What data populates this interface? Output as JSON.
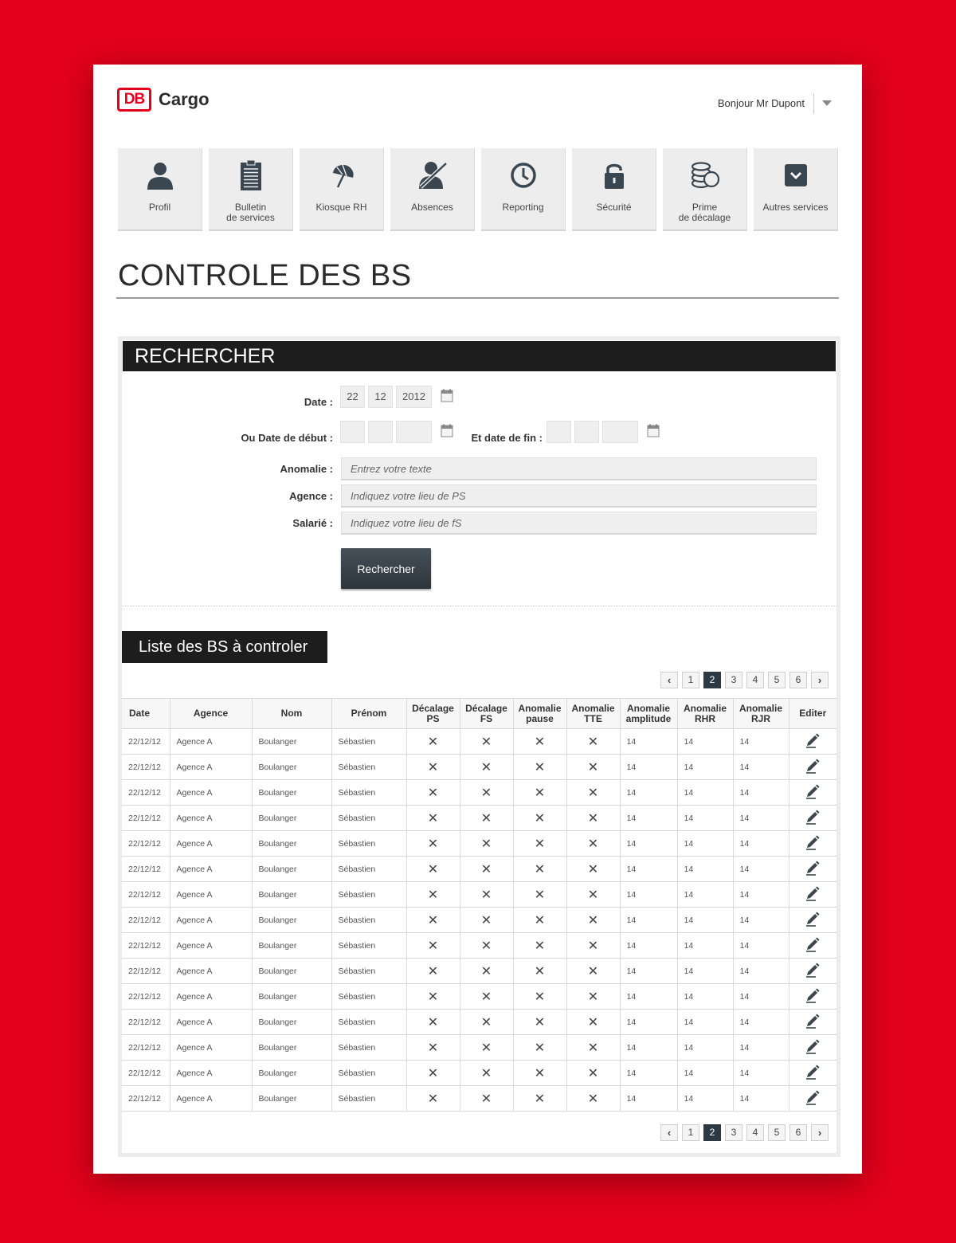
{
  "brand": {
    "logo_mark": "DB",
    "logo_text": "Cargo"
  },
  "header": {
    "greeting": "Bonjour Mr Dupont"
  },
  "nav": [
    {
      "label": "Profil",
      "icon": "user-icon"
    },
    {
      "label": "Bulletin\nde services",
      "icon": "clipboard-icon"
    },
    {
      "label": "Kiosque RH",
      "icon": "umbrella-icon"
    },
    {
      "label": "Absences",
      "icon": "user-crossed-icon"
    },
    {
      "label": "Reporting",
      "icon": "clock-icon"
    },
    {
      "label": "Sécurité",
      "icon": "lock-icon"
    },
    {
      "label": "Prime\nde décalage",
      "icon": "coins-icon"
    },
    {
      "label": "Autres services",
      "icon": "chevron-box-icon"
    }
  ],
  "page_title": "CONTROLE DES BS",
  "search": {
    "heading": "RECHERCHER",
    "date_label": "Date :",
    "date_day": "22",
    "date_month": "12",
    "date_year": "2012",
    "start_label": "Ou Date de début :",
    "end_label": "Et date de fin :",
    "anomalie_label": "Anomalie :",
    "anomalie_placeholder": "Entrez votre texte",
    "agence_label": "Agence :",
    "agence_placeholder": "Indiquez votre lieu de PS",
    "salarie_label": "Salarié :",
    "salarie_placeholder": "Indiquez votre lieu de fS",
    "button": "Rechercher"
  },
  "list": {
    "heading": "Liste des BS à controler",
    "pages": [
      "1",
      "2",
      "3",
      "4",
      "5",
      "6"
    ],
    "active_page": "2",
    "columns": [
      "Date",
      "Agence",
      "Nom",
      "Prénom",
      "Décalage\nPS",
      "Décalage\nFS",
      "Anomalie\npause",
      "Anomalie\nTTE",
      "Anomalie\namplitude",
      "Anomalie\nRHR",
      "Anomalie\nRJR",
      "Editer"
    ],
    "rows": [
      [
        "22/12/12",
        "Agence A",
        "Boulanger",
        "Sébastien",
        "✕",
        "✕",
        "✕",
        "✕",
        "14",
        "14",
        "14"
      ],
      [
        "22/12/12",
        "Agence A",
        "Boulanger",
        "Sébastien",
        "✕",
        "✕",
        "✕",
        "✕",
        "14",
        "14",
        "14"
      ],
      [
        "22/12/12",
        "Agence A",
        "Boulanger",
        "Sébastien",
        "✕",
        "✕",
        "✕",
        "✕",
        "14",
        "14",
        "14"
      ],
      [
        "22/12/12",
        "Agence A",
        "Boulanger",
        "Sébastien",
        "✕",
        "✕",
        "✕",
        "✕",
        "14",
        "14",
        "14"
      ],
      [
        "22/12/12",
        "Agence A",
        "Boulanger",
        "Sébastien",
        "✕",
        "✕",
        "✕",
        "✕",
        "14",
        "14",
        "14"
      ],
      [
        "22/12/12",
        "Agence A",
        "Boulanger",
        "Sébastien",
        "✕",
        "✕",
        "✕",
        "✕",
        "14",
        "14",
        "14"
      ],
      [
        "22/12/12",
        "Agence A",
        "Boulanger",
        "Sébastien",
        "✕",
        "✕",
        "✕",
        "✕",
        "14",
        "14",
        "14"
      ],
      [
        "22/12/12",
        "Agence A",
        "Boulanger",
        "Sébastien",
        "✕",
        "✕",
        "✕",
        "✕",
        "14",
        "14",
        "14"
      ],
      [
        "22/12/12",
        "Agence A",
        "Boulanger",
        "Sébastien",
        "✕",
        "✕",
        "✕",
        "✕",
        "14",
        "14",
        "14"
      ],
      [
        "22/12/12",
        "Agence A",
        "Boulanger",
        "Sébastien",
        "✕",
        "✕",
        "✕",
        "✕",
        "14",
        "14",
        "14"
      ],
      [
        "22/12/12",
        "Agence A",
        "Boulanger",
        "Sébastien",
        "✕",
        "✕",
        "✕",
        "✕",
        "14",
        "14",
        "14"
      ],
      [
        "22/12/12",
        "Agence A",
        "Boulanger",
        "Sébastien",
        "✕",
        "✕",
        "✕",
        "✕",
        "14",
        "14",
        "14"
      ],
      [
        "22/12/12",
        "Agence A",
        "Boulanger",
        "Sébastien",
        "✕",
        "✕",
        "✕",
        "✕",
        "14",
        "14",
        "14"
      ],
      [
        "22/12/12",
        "Agence A",
        "Boulanger",
        "Sébastien",
        "✕",
        "✕",
        "✕",
        "✕",
        "14",
        "14",
        "14"
      ],
      [
        "22/12/12",
        "Agence A",
        "Boulanger",
        "Sébastien",
        "✕",
        "✕",
        "✕",
        "✕",
        "14",
        "14",
        "14"
      ]
    ]
  },
  "colors": {
    "brand_red": "#e3001b",
    "dark": "#1d1d1d",
    "button": "#2d353c"
  }
}
